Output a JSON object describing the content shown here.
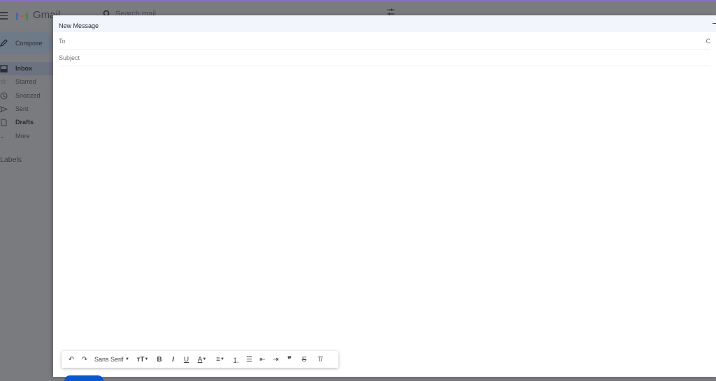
{
  "app": {
    "name": "Gmail"
  },
  "header": {
    "search_placeholder": "Search mail"
  },
  "sidebar": {
    "compose_label": "Compose",
    "items": [
      {
        "label": "Inbox",
        "icon": "inbox-icon",
        "active": true
      },
      {
        "label": "Starred",
        "icon": "star-icon"
      },
      {
        "label": "Snoozed",
        "icon": "clock-icon"
      },
      {
        "label": "Sent",
        "icon": "send-icon"
      },
      {
        "label": "Drafts",
        "icon": "draft-icon",
        "bold": true
      },
      {
        "label": "More",
        "icon": "chevron-down-icon"
      }
    ],
    "labels_heading": "Labels"
  },
  "compose": {
    "title": "New Message",
    "to_label": "To",
    "to_value": "",
    "cc_label": "C",
    "subject_label": "Subject",
    "subject_value": "",
    "body": ""
  },
  "toolbar": {
    "undo": "↶",
    "redo": "↷",
    "font": "Sans Serif",
    "size": "тT",
    "bold": "B",
    "italic": "I",
    "underline": "U",
    "text_color": "A",
    "align": "≡",
    "numbered_list": "⒈",
    "bulleted_list": "☰",
    "indent_less": "⇤",
    "indent_more": "⇥",
    "quote": "❞",
    "strikethrough": "S",
    "remove_format": "T̸"
  },
  "colors": {
    "accent": "#0b57d0",
    "compose_header_bg": "#f2f5fc"
  }
}
